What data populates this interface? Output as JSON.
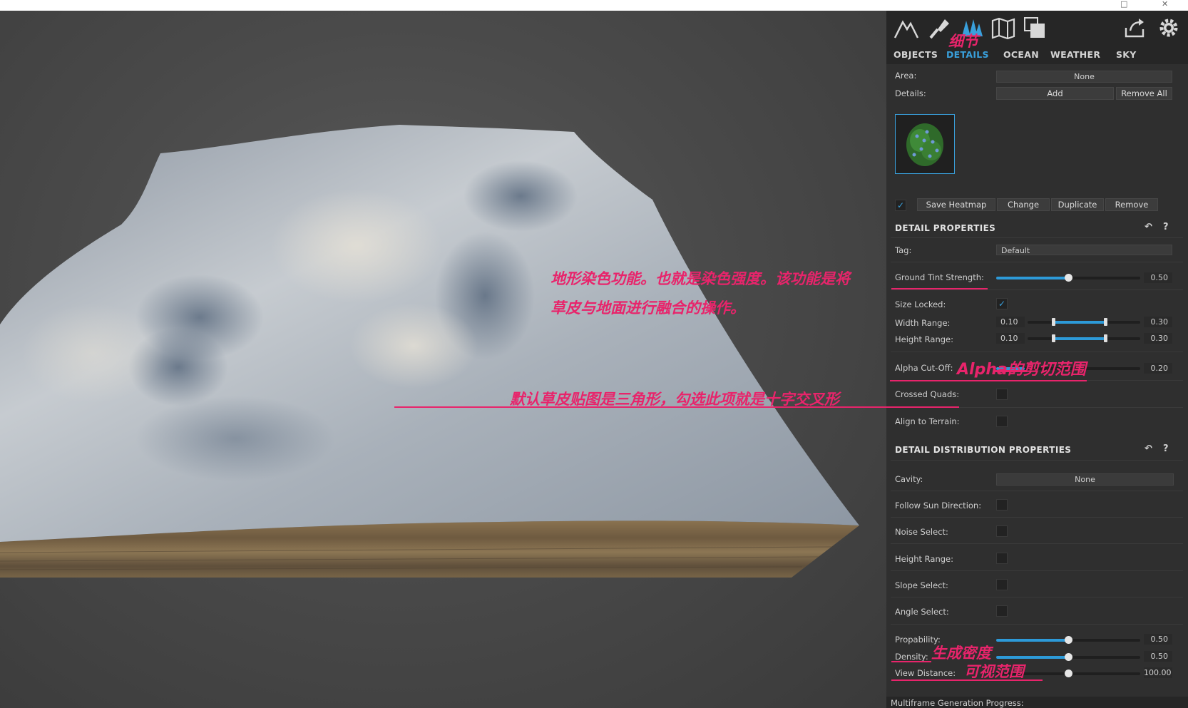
{
  "panel": {
    "tabs": [
      {
        "label": "OBJECTS",
        "active": false
      },
      {
        "label": "DETAILS",
        "active": true
      },
      {
        "label": "OCEAN",
        "active": false
      },
      {
        "label": "WEATHER",
        "active": false
      },
      {
        "label": "SKY",
        "active": false
      }
    ],
    "toolbar_icons": [
      "mountain-icon",
      "brush-icon",
      "trees-icon",
      "map-icon",
      "layers-icon",
      "export-icon",
      "gear-icon"
    ],
    "area": {
      "label": "Area:",
      "value": "None"
    },
    "details": {
      "label": "Details:",
      "add_label": "Add",
      "remove_all_label": "Remove All"
    },
    "actions": {
      "enabled": true,
      "save_heatmap": "Save Heatmap",
      "change": "Change",
      "duplicate": "Duplicate",
      "remove": "Remove"
    },
    "detail_properties": {
      "title": "DETAIL PROPERTIES",
      "tag": {
        "label": "Tag:",
        "value": "Default"
      },
      "ground_tint": {
        "label": "Ground Tint Strength:",
        "value": "0.50",
        "fraction": 0.5
      },
      "size_locked": {
        "label": "Size Locked:",
        "checked": true
      },
      "width_range": {
        "label": "Width Range:",
        "min": "0.10",
        "max": "0.30"
      },
      "height_range": {
        "label": "Height Range:",
        "min": "0.10",
        "max": "0.30"
      },
      "alpha_cutoff": {
        "label": "Alpha Cut-Off:",
        "value": "0.20",
        "fraction": 0.2
      },
      "crossed_quads": {
        "label": "Crossed Quads:",
        "checked": false
      },
      "align_to_terrain": {
        "label": "Align to Terrain:",
        "checked": false
      }
    },
    "distribution": {
      "title": "DETAIL DISTRIBUTION PROPERTIES",
      "cavity": {
        "label": "Cavity:",
        "value": "None"
      },
      "follow_sun": {
        "label": "Follow Sun Direction:"
      },
      "noise_select": {
        "label": "Noise Select:"
      },
      "height_range": {
        "label": "Height Range:"
      },
      "slope_select": {
        "label": "Slope Select:"
      },
      "angle_select": {
        "label": "Angle Select:"
      },
      "probability": {
        "label": "Propability:",
        "value": "0.50",
        "fraction": 0.5
      },
      "density": {
        "label": "Density:",
        "value": "0.50",
        "fraction": 0.5
      },
      "view_distance": {
        "label": "View Distance:",
        "value": "100.00",
        "fraction": 0.5
      }
    },
    "footer": "Multiframe Generation Progress:"
  },
  "annotations": {
    "details_tab": "细节",
    "ground_tint_line1": "地形染色功能。也就是染色强度。该功能是将",
    "ground_tint_line2": "草皮与地面进行融合的操作。",
    "alpha_cutoff": "Alpha的剪切范围",
    "crossed_quads": "默认草皮贴图是三角形，勾选此项就是十字交叉形",
    "density": "生成密度",
    "view_distance": "可视范围"
  },
  "colors": {
    "accent": "#39a0dc",
    "annotation": "#e8246b",
    "panel_bg": "#2f2f2f"
  }
}
